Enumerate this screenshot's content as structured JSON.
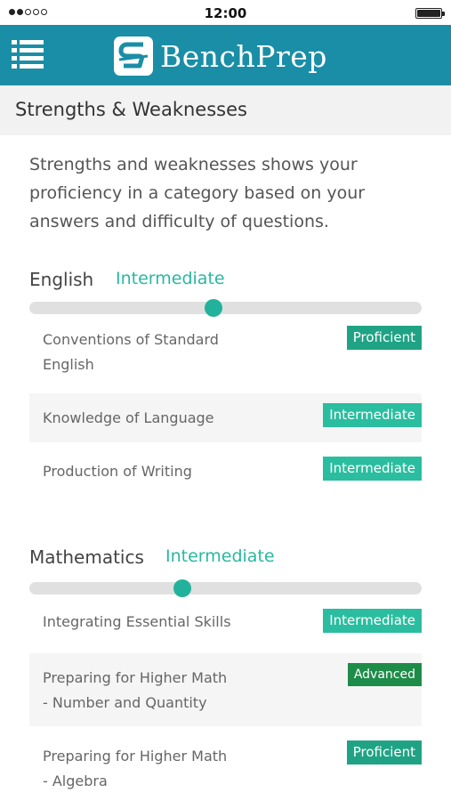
{
  "status_bar": {
    "time": "12:00"
  },
  "header": {
    "brand": "BenchPrep",
    "menu_icon": "menu-list-icon"
  },
  "page": {
    "title": "Strengths & Weaknesses"
  },
  "intro": "Strengths and weaknesses shows your proficiency in a category based on your answers and difficulty of questions.",
  "colors": {
    "header": "#1a8ea6",
    "intermediate": "#2bbd9f",
    "proficient": "#20a384",
    "advanced": "#1e8c49",
    "accent_text": "#28b8a0"
  },
  "sections": [
    {
      "name": "English",
      "level": "Intermediate",
      "progress": 0.47,
      "items": [
        {
          "label_lines": [
            "Conventions of Standard",
            "English"
          ],
          "badge": "Proficient"
        },
        {
          "label_lines": [
            "Knowledge of Language"
          ],
          "badge": "Intermediate"
        },
        {
          "label_lines": [
            "Production of Writing"
          ],
          "badge": "Intermediate"
        }
      ]
    },
    {
      "name": "Mathematics",
      "level": "Intermediate",
      "progress": 0.39,
      "items": [
        {
          "label_lines": [
            "Integrating Essential Skills"
          ],
          "badge": "Intermediate"
        },
        {
          "label_lines": [
            "Preparing for Higher Math",
            "- Number and Quantity"
          ],
          "badge": "Advanced"
        },
        {
          "label_lines": [
            "Preparing for Higher Math",
            "- Algebra"
          ],
          "badge": "Proficient"
        }
      ]
    }
  ]
}
